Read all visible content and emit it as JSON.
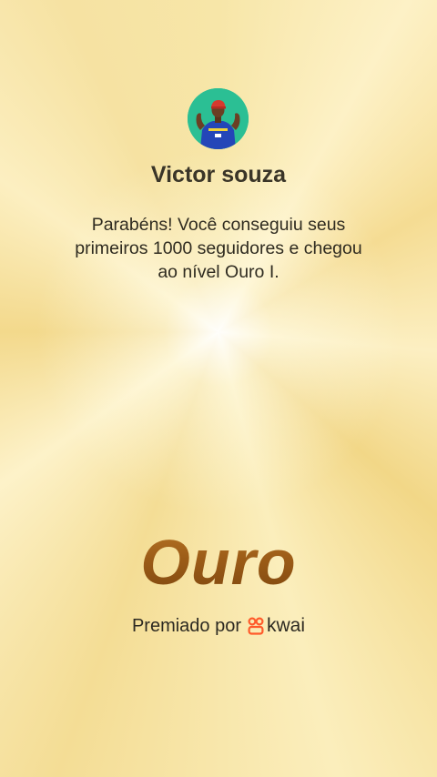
{
  "profile": {
    "name": "Victor souza",
    "avatar_icon": "user-avatar-photo"
  },
  "message": {
    "line1": "Parabéns! Você conseguiu seus",
    "line2": "primeiros 1000 seguidores e chegou",
    "line3": "ao nível Ouro I."
  },
  "badge": {
    "title": "Ouro"
  },
  "footer": {
    "awarded_by": "Premiado por",
    "brand": "kwai",
    "logo_icon": "kwai-logo-icon"
  },
  "colors": {
    "badge_text": "#9a5b17",
    "brand_logo": "#ff5a2a",
    "avatar_bg": "#2bbf94"
  }
}
